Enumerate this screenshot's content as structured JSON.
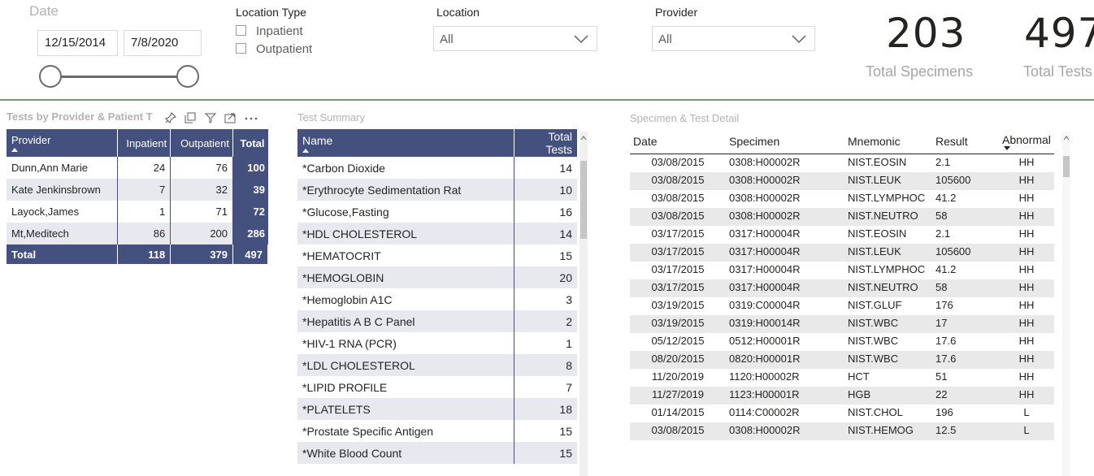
{
  "filters": {
    "date": {
      "title": "Date",
      "start": "12/15/2014",
      "end": "7/8/2020"
    },
    "location_type": {
      "title": "Location Type",
      "options": [
        "Inpatient",
        "Outpatient"
      ]
    },
    "location": {
      "title": "Location",
      "value": "All"
    },
    "provider": {
      "title": "Provider",
      "value": "All"
    }
  },
  "kpis": {
    "specimens": {
      "value": "203",
      "label": "Total Specimens"
    },
    "tests": {
      "value": "497",
      "label": "Total Tests"
    }
  },
  "provider_matrix": {
    "title": "Tests by Provider & Patient T",
    "headers": [
      "Provider",
      "Inpatient",
      "Outpatient",
      "Total"
    ],
    "rows": [
      {
        "provider": "Dunn,Ann Marie",
        "inpatient": "24",
        "outpatient": "76",
        "total": "100"
      },
      {
        "provider": "Kate Jenkinsbrown",
        "inpatient": "7",
        "outpatient": "32",
        "total": "39"
      },
      {
        "provider": "Layock,James",
        "inpatient": "1",
        "outpatient": "71",
        "total": "72"
      },
      {
        "provider": "Mt,Meditech",
        "inpatient": "86",
        "outpatient": "200",
        "total": "286"
      }
    ],
    "grand": {
      "label": "Total",
      "inpatient": "118",
      "outpatient": "379",
      "total": "497"
    }
  },
  "test_summary": {
    "title": "Test Summary",
    "headers": [
      "Name",
      "Total Tests"
    ],
    "rows": [
      {
        "name": "*Carbon Dioxide",
        "total": "14"
      },
      {
        "name": "*Erythrocyte Sedimentation Rat",
        "total": "10"
      },
      {
        "name": "*Glucose,Fasting",
        "total": "16"
      },
      {
        "name": "*HDL CHOLESTEROL",
        "total": "14"
      },
      {
        "name": "*HEMATOCRIT",
        "total": "15"
      },
      {
        "name": "*HEMOGLOBIN",
        "total": "20"
      },
      {
        "name": "*Hemoglobin A1C",
        "total": "3"
      },
      {
        "name": "*Hepatitis A B C Panel",
        "total": "2"
      },
      {
        "name": "*HIV-1 RNA (PCR)",
        "total": "1"
      },
      {
        "name": "*LDL CHOLESTEROL",
        "total": "8"
      },
      {
        "name": "*LIPID PROFILE",
        "total": "7"
      },
      {
        "name": "*PLATELETS",
        "total": "18"
      },
      {
        "name": "*Prostate Specific Antigen",
        "total": "15"
      },
      {
        "name": "*White Blood Count",
        "total": "15"
      }
    ]
  },
  "detail": {
    "title": "Specimen & Test Detail",
    "headers": [
      "Date",
      "Specimen",
      "Mnemonic",
      "Result",
      "Abnormal"
    ],
    "rows": [
      {
        "date": "03/08/2015",
        "specimen": "0308:H00002R",
        "mnemonic": "NIST.EOSIN",
        "result": "2.1",
        "abnormal": "HH"
      },
      {
        "date": "03/08/2015",
        "specimen": "0308:H00002R",
        "mnemonic": "NIST.LEUK",
        "result": "105600",
        "abnormal": "HH"
      },
      {
        "date": "03/08/2015",
        "specimen": "0308:H00002R",
        "mnemonic": "NIST.LYMPHOC",
        "result": "41.2",
        "abnormal": "HH"
      },
      {
        "date": "03/08/2015",
        "specimen": "0308:H00002R",
        "mnemonic": "NIST.NEUTRO",
        "result": "58",
        "abnormal": "HH"
      },
      {
        "date": "03/17/2015",
        "specimen": "0317:H00004R",
        "mnemonic": "NIST.EOSIN",
        "result": "2.1",
        "abnormal": "HH"
      },
      {
        "date": "03/17/2015",
        "specimen": "0317:H00004R",
        "mnemonic": "NIST.LEUK",
        "result": "105600",
        "abnormal": "HH"
      },
      {
        "date": "03/17/2015",
        "specimen": "0317:H00004R",
        "mnemonic": "NIST.LYMPHOC",
        "result": "41.2",
        "abnormal": "HH"
      },
      {
        "date": "03/17/2015",
        "specimen": "0317:H00004R",
        "mnemonic": "NIST.NEUTRO",
        "result": "58",
        "abnormal": "HH"
      },
      {
        "date": "03/19/2015",
        "specimen": "0319:C00004R",
        "mnemonic": "NIST.GLUF",
        "result": "176",
        "abnormal": "HH"
      },
      {
        "date": "03/19/2015",
        "specimen": "0319:H00014R",
        "mnemonic": "NIST.WBC",
        "result": "17",
        "abnormal": "HH"
      },
      {
        "date": "05/12/2015",
        "specimen": "0512:H00001R",
        "mnemonic": "NIST.WBC",
        "result": "17.6",
        "abnormal": "HH"
      },
      {
        "date": "08/20/2015",
        "specimen": "0820:H00001R",
        "mnemonic": "NIST.WBC",
        "result": "17.6",
        "abnormal": "HH"
      },
      {
        "date": "11/20/2019",
        "specimen": "1120:H00002R",
        "mnemonic": "HCT",
        "result": "51",
        "abnormal": "HH"
      },
      {
        "date": "11/27/2019",
        "specimen": "1123:H00001R",
        "mnemonic": "HGB",
        "result": "22",
        "abnormal": "HH"
      },
      {
        "date": "01/14/2015",
        "specimen": "0114:C00002R",
        "mnemonic": "NIST.CHOL",
        "result": "196",
        "abnormal": "L"
      },
      {
        "date": "03/08/2015",
        "specimen": "0308:H00002R",
        "mnemonic": "NIST.HEMOG",
        "result": "12.5",
        "abnormal": "L"
      }
    ]
  },
  "colors": {
    "header": "#44507e",
    "divider": "#6f9b6a",
    "alt_row": "#e8e9ef"
  },
  "icons": [
    "pin-icon",
    "copy-icon",
    "filter-icon",
    "focus-mode-icon",
    "more-options-icon",
    "chevron-down-icon"
  ]
}
